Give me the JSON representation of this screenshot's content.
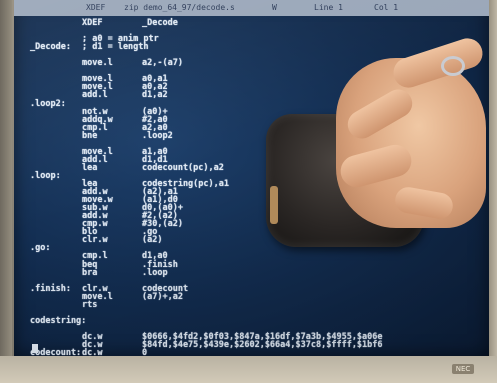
{
  "screen": {
    "statusbar": {
      "left": "XDEF",
      "file": "zip demo_64_97/decode.s",
      "col": "W",
      "line": "Line 1",
      "mode": "Col 1"
    },
    "lines": [
      {
        "label": "",
        "op": "XDEF",
        "arg": "_Decode"
      },
      {
        "label": "",
        "op": "",
        "arg": ""
      },
      {
        "label": "",
        "op": "; a0 = anim ptr",
        "arg": ""
      },
      {
        "label": "_Decode:",
        "op": "; d1 = length",
        "arg": ""
      },
      {
        "label": "",
        "op": "",
        "arg": ""
      },
      {
        "label": "",
        "op": "move.l",
        "arg": "a2,-(a7)"
      },
      {
        "label": "",
        "op": "",
        "arg": ""
      },
      {
        "label": "",
        "op": "move.l",
        "arg": "a0,a1"
      },
      {
        "label": "",
        "op": "move.l",
        "arg": "a0,a2"
      },
      {
        "label": "",
        "op": "add.l",
        "arg": "d1,a2"
      },
      {
        "label": ".loop2:",
        "op": "",
        "arg": ""
      },
      {
        "label": "",
        "op": "not.w",
        "arg": "(a0)+"
      },
      {
        "label": "",
        "op": "addq.w",
        "arg": "#2,a0"
      },
      {
        "label": "",
        "op": "cmp.l",
        "arg": "a2,a0"
      },
      {
        "label": "",
        "op": "bne",
        "arg": ".loop2"
      },
      {
        "label": "",
        "op": "",
        "arg": ""
      },
      {
        "label": "",
        "op": "move.l",
        "arg": "a1,a0"
      },
      {
        "label": "",
        "op": "add.l",
        "arg": "d1,d1"
      },
      {
        "label": "",
        "op": "lea",
        "arg": "codecount(pc),a2"
      },
      {
        "label": ".loop:",
        "op": "",
        "arg": ""
      },
      {
        "label": "",
        "op": "lea",
        "arg": "codestring(pc),a1"
      },
      {
        "label": "",
        "op": "add.w",
        "arg": "(a2),a1"
      },
      {
        "label": "",
        "op": "move.w",
        "arg": "(a1),d0"
      },
      {
        "label": "",
        "op": "sub.w",
        "arg": "d0,(a0)+"
      },
      {
        "label": "",
        "op": "add.w",
        "arg": "#2,(a2)"
      },
      {
        "label": "",
        "op": "cmp.w",
        "arg": "#30,(a2)"
      },
      {
        "label": "",
        "op": "blo",
        "arg": ".go"
      },
      {
        "label": "",
        "op": "clr.w",
        "arg": "(a2)"
      },
      {
        "label": ".go:",
        "op": "",
        "arg": ""
      },
      {
        "label": "",
        "op": "cmp.l",
        "arg": "d1,a0"
      },
      {
        "label": "",
        "op": "beq",
        "arg": ".finish"
      },
      {
        "label": "",
        "op": "bra",
        "arg": ".loop"
      },
      {
        "label": "",
        "op": "",
        "arg": ""
      },
      {
        "label": ".finish:",
        "op": "clr.w",
        "arg": "codecount"
      },
      {
        "label": "",
        "op": "move.l",
        "arg": "(a7)+,a2"
      },
      {
        "label": "",
        "op": "rts",
        "arg": ""
      },
      {
        "label": "",
        "op": "",
        "arg": ""
      },
      {
        "label": "codestring:",
        "op": "",
        "arg": ""
      },
      {
        "label": "",
        "op": "",
        "arg": ""
      },
      {
        "label": "",
        "op": "dc.w",
        "arg": "$0666,$4fd2,$0f03,$847a,$16df,$7a3b,$4955,$a06e"
      },
      {
        "label": "",
        "op": "dc.w",
        "arg": "$84fd,$4e75,$439e,$2602,$66a4,$37c8,$ffff,$1bf6"
      },
      {
        "label": "codecount:",
        "op": "dc.w",
        "arg": "0"
      }
    ]
  },
  "overlay": {
    "brand": "NEC"
  }
}
